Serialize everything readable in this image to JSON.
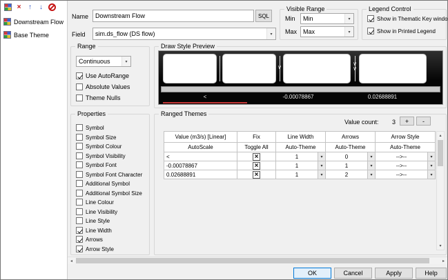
{
  "icons": {
    "delete": "×",
    "move_up": "↑",
    "move_down": "↓",
    "dropdown": "▾",
    "chevron": "∨",
    "scroll_up": "▴",
    "scroll_down": "▾",
    "scroll_left": "◂",
    "scroll_right": "▸"
  },
  "sidebar": {
    "items": [
      "Downstream Flow",
      "Base Theme"
    ]
  },
  "form": {
    "name_label": "Name",
    "name_value": "Downstream Flow",
    "sql_button": "SQL",
    "field_label": "Field",
    "field_value": "sim.ds_flow (DS flow)"
  },
  "visible_range": {
    "title": "Visible Range",
    "min_label": "Min",
    "min_value": "Min",
    "max_label": "Max",
    "max_value": "Max"
  },
  "legend_control": {
    "title": "Legend Control",
    "options": [
      {
        "label": "Show in Thematic Key window",
        "checked": true
      },
      {
        "label": "Show in Printed Legend",
        "checked": true
      }
    ]
  },
  "range": {
    "title": "Range",
    "mode": "Continuous",
    "options": [
      {
        "label": "Use AutoRange",
        "checked": true
      },
      {
        "label": "Absolute Values",
        "checked": false
      },
      {
        "label": "Theme Nulls",
        "checked": false
      }
    ]
  },
  "preview": {
    "title": "Draw Style Preview",
    "labels": [
      "<",
      "-0.00078867",
      "0.02688891"
    ]
  },
  "properties": {
    "title": "Properties",
    "options": [
      {
        "label": "Symbol",
        "checked": false
      },
      {
        "label": "Symbol Size",
        "checked": false
      },
      {
        "label": "Symbol Colour",
        "checked": false
      },
      {
        "label": "Symbol Visibility",
        "checked": false
      },
      {
        "label": "Symbol Font",
        "checked": false
      },
      {
        "label": "Symbol Font Character",
        "checked": false
      },
      {
        "label": "Additional Symbol",
        "checked": false
      },
      {
        "label": "Additional Symbol Size",
        "checked": false
      },
      {
        "label": "Line Colour",
        "checked": false
      },
      {
        "label": "Line Visibility",
        "checked": false
      },
      {
        "label": "Line Style",
        "checked": false
      },
      {
        "label": "Line Width",
        "checked": true
      },
      {
        "label": "Arrows",
        "checked": true
      },
      {
        "label": "Arrow Style",
        "checked": true
      }
    ]
  },
  "ranged_themes": {
    "title": "Ranged Themes",
    "value_count_label": "Value count:",
    "value_count": "3",
    "add_button": "+",
    "remove_button": "-",
    "table": {
      "headers": [
        "Value (m3/s) [Linear]",
        "Fix",
        "Line Width",
        "Arrows",
        "Arrow Style"
      ],
      "subheaders": [
        "AutoScale",
        "Toggle All",
        "Auto-Theme",
        "Auto-Theme",
        "Auto-Theme"
      ],
      "rows": [
        {
          "value": "<",
          "fix": true,
          "line_width": "1",
          "arrows": "0",
          "arrow_style": "-->--"
        },
        {
          "value": "-0.00078867",
          "fix": true,
          "line_width": "1",
          "arrows": "1",
          "arrow_style": "-->--"
        },
        {
          "value": "0.02688891",
          "fix": true,
          "line_width": "1",
          "arrows": "2",
          "arrow_style": "-->--"
        }
      ]
    }
  },
  "buttons": {
    "ok": "OK",
    "cancel": "Cancel",
    "apply": "Apply",
    "help": "Help"
  }
}
